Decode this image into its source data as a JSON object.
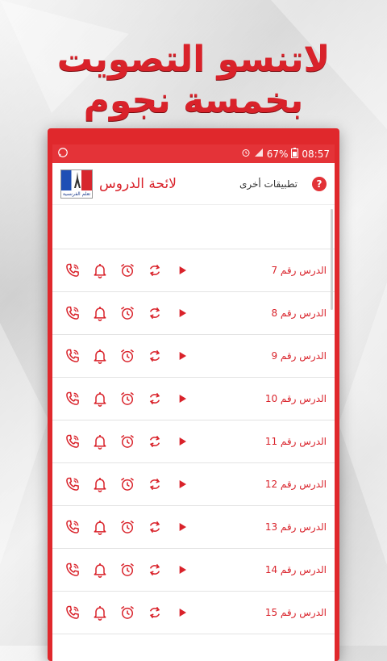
{
  "promo_banner": "لاتنسو التصويت بخمسة نجوم",
  "status_bar": {
    "battery_percent": "67%",
    "time": "08:57"
  },
  "app_bar": {
    "title": "لائحة الدروس",
    "other_apps_label": "تطبيقات أخرى",
    "help_label": "?",
    "logo_text": "تعلم الفرنسية بسهولة"
  },
  "lessons": [
    {
      "label": "الدرس رقم 7"
    },
    {
      "label": "الدرس رقم 8"
    },
    {
      "label": "الدرس رقم 9"
    },
    {
      "label": "الدرس رقم 10"
    },
    {
      "label": "الدرس رقم 11"
    },
    {
      "label": "الدرس رقم 12"
    },
    {
      "label": "الدرس رقم 13"
    },
    {
      "label": "الدرس رقم 14"
    },
    {
      "label": "الدرس رقم 15"
    }
  ],
  "row_icons": [
    "phone-ringtone-icon",
    "bell-notification-icon",
    "alarm-clock-icon",
    "repeat-icon",
    "play-icon"
  ],
  "colors": {
    "accent": "#e43338",
    "text_red": "#d9222a"
  }
}
